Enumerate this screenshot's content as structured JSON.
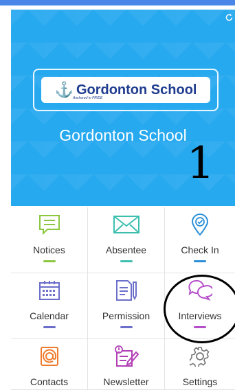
{
  "hero": {
    "logo_text": "Gordonton School",
    "logo_subtext": "Anchored in PRIDE",
    "school_name": "Gordonton School",
    "annotation": "1"
  },
  "colors": {
    "top_bar": "#4a86e8",
    "hero_bg": "#27a9ef",
    "notices": "#8cc63f",
    "absentee": "#3dbfb0",
    "check_in": "#2a8fd8",
    "calendar": "#6c6fc9",
    "permission": "#6c6fc9",
    "interviews": "#b44fc9",
    "contacts": "#f07a2b",
    "newsletter": "#b13eb5",
    "settings": "#777777"
  },
  "tiles": [
    {
      "label": "Notices",
      "icon": "notice-icon"
    },
    {
      "label": "Absentee",
      "icon": "envelope-icon"
    },
    {
      "label": "Check In",
      "icon": "location-check-icon"
    },
    {
      "label": "Calendar",
      "icon": "calendar-icon"
    },
    {
      "label": "Permission",
      "icon": "permission-form-icon"
    },
    {
      "label": "Interviews",
      "icon": "chat-bubbles-icon"
    },
    {
      "label": "Contacts",
      "icon": "contact-at-icon"
    },
    {
      "label": "Newsletter",
      "icon": "newsletter-icon"
    },
    {
      "label": "Settings",
      "icon": "gear-icon"
    }
  ]
}
